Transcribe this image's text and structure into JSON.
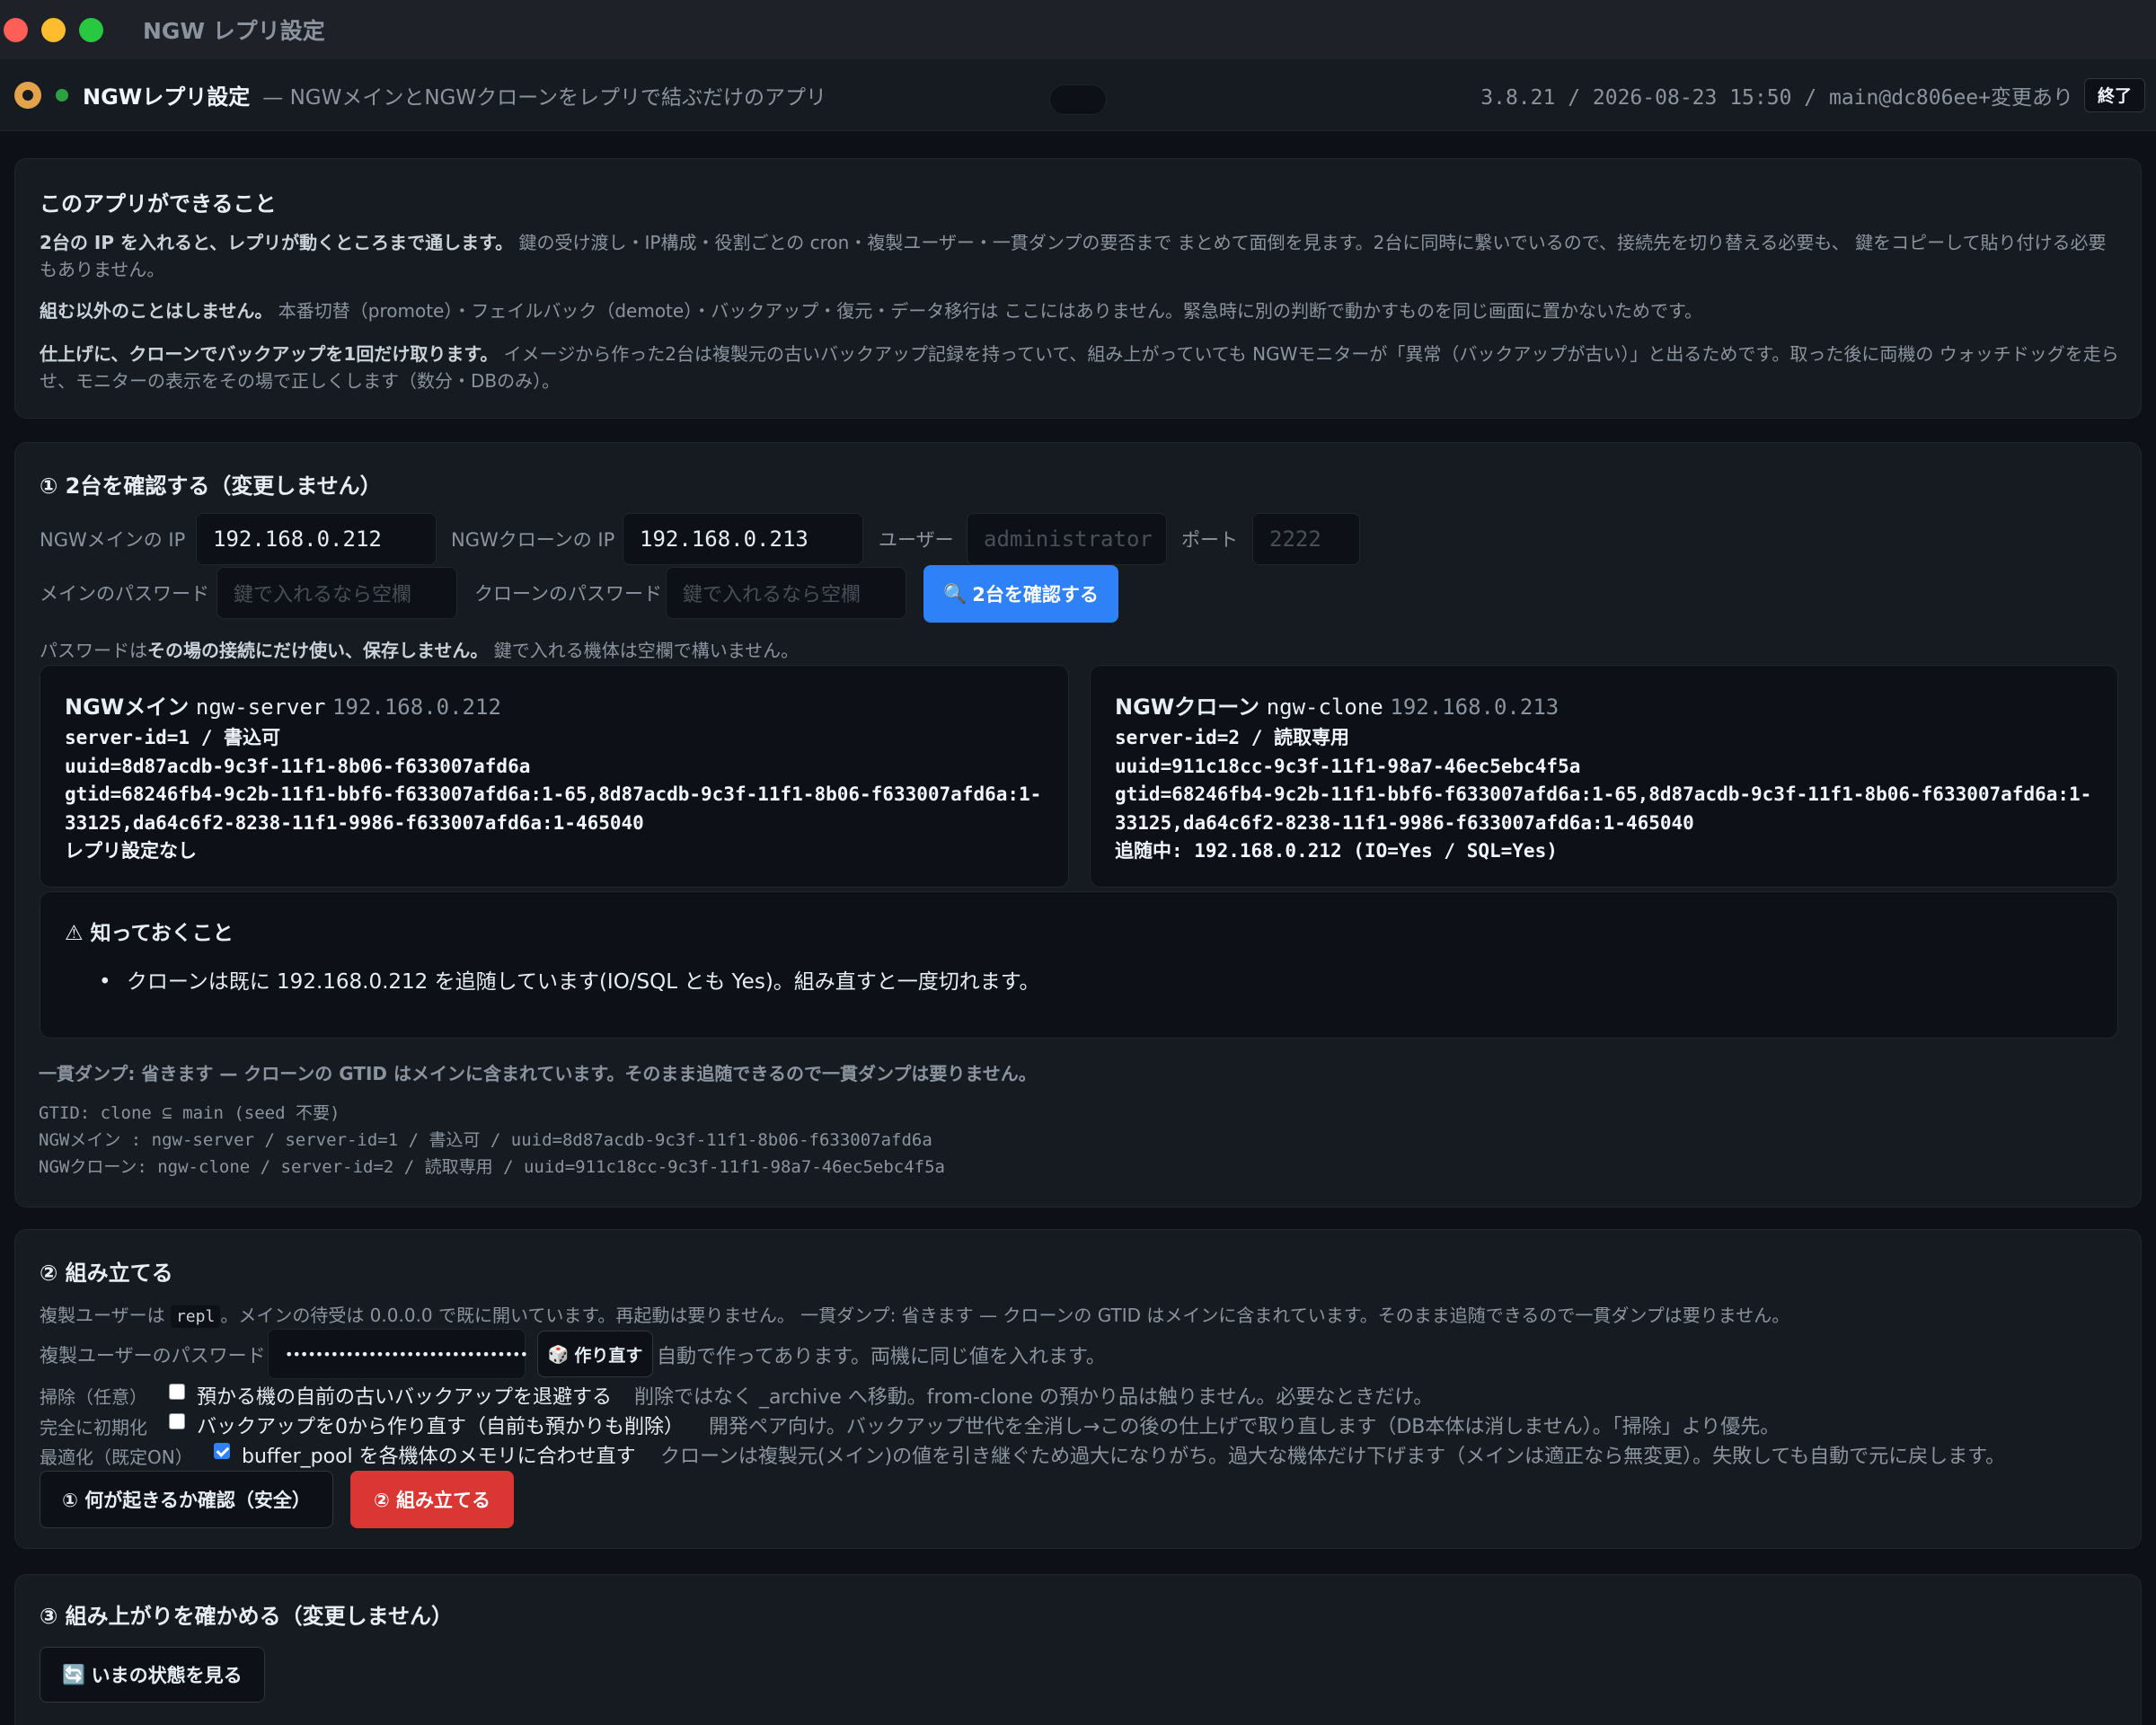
{
  "window": {
    "title": "NGW レプリ設定"
  },
  "header": {
    "app_name": "NGWレプリ設定",
    "description": "— NGWメインとNGWクローンをレプリで結ぶだけのアプリ",
    "version": "3.8.21 / 2026-08-23 15:50 / main@dc806ee+変更あり",
    "quit_label": "終了"
  },
  "intro": {
    "title": "このアプリができること",
    "p1_bold": "2台の IP を入れると、レプリが動くところまで通します。",
    "p1_text": " 鍵の受け渡し・IP構成・役割ごとの cron・複製ユーザー・一貫ダンプの要否まで まとめて面倒を見ます。2台に同時に繋いでいるので、接続先を切り替える必要も、 鍵をコピーして貼り付ける必要もありません。",
    "p2_bold": "組む以外のことはしません。",
    "p2_text": " 本番切替（promote）・フェイルバック（demote）・バックアップ・復元・データ移行は ここにはありません。緊急時に別の判断で動かすものを同じ画面に置かないためです。",
    "p3_bold": "仕上げに、クローンでバックアップを1回だけ取ります。",
    "p3_text": " イメージから作った2台は複製元の古いバックアップ記録を持っていて、組み上がっていても NGWモニターが「異常（バックアップが古い）」と出るためです。取った後に両機の ウォッチドッグを走らせ、モニターの表示をその場で正しくします（数分・DBのみ）。"
  },
  "step1": {
    "title": "① 2台を確認する（変更しません）",
    "main_ip_label": "NGWメインの IP",
    "main_ip_value": "192.168.0.212",
    "clone_ip_label": "NGWクローンの IP",
    "clone_ip_value": "192.168.0.213",
    "user_label": "ユーザー",
    "user_placeholder": "administrator",
    "port_label": "ポート",
    "port_placeholder": "2222",
    "main_pw_label": "メインのパスワード",
    "main_pw_placeholder": "鍵で入れるなら空欄",
    "clone_pw_label": "クローンのパスワード",
    "clone_pw_placeholder": "鍵で入れるなら空欄",
    "check_button": "2台を確認する",
    "note_plain1": "パスワードは",
    "note_bold": "その場の接続にだけ使い、保存しません。",
    "note_plain2": " 鍵で入れる機体は空欄で構いません。",
    "main_box": {
      "role": "NGWメイン",
      "host": "ngw-server",
      "ip": "192.168.0.212",
      "lines": [
        "server-id=1 / 書込可",
        "uuid=8d87acdb-9c3f-11f1-8b06-f633007afd6a",
        "gtid=68246fb4-9c2b-11f1-bbf6-f633007afd6a:1-65,8d87acdb-9c3f-11f1-8b06-f633007afd6a:1-",
        "33125,da64c6f2-8238-11f1-9986-f633007afd6a:1-465040",
        "レプリ設定なし"
      ]
    },
    "clone_box": {
      "role": "NGWクローン",
      "host": "ngw-clone",
      "ip": "192.168.0.213",
      "lines": [
        "server-id=2 / 読取専用",
        "uuid=911c18cc-9c3f-11f1-98a7-46ec5ebc4f5a",
        "gtid=68246fb4-9c2b-11f1-bbf6-f633007afd6a:1-65,8d87acdb-9c3f-11f1-8b06-f633007afd6a:1-",
        "33125,da64c6f2-8238-11f1-9986-f633007afd6a:1-465040",
        "追随中: 192.168.0.212 (IO=Yes / SQL=Yes)"
      ]
    },
    "notice_title": "知っておくこと",
    "notice_items": [
      "クローンは既に 192.168.0.212 を追随しています(IO/SQL とも Yes)。組み直すと一度切れます。"
    ],
    "dump_summary": "一貫ダンプ: 省きます — クローンの GTID はメインに含まれています。そのまま追随できるので一貫ダンプは要りません。",
    "mono_lines": [
      "GTID: clone ⊆ main (seed 不要)",
      "NGWメイン : ngw-server / server-id=1 / 書込可 / uuid=8d87acdb-9c3f-11f1-8b06-f633007afd6a",
      "NGWクローン: ngw-clone / server-id=2 / 読取専用 / uuid=911c18cc-9c3f-11f1-98a7-46ec5ebc4f5a"
    ]
  },
  "step2": {
    "title": "② 組み立てる",
    "repl_text_before": "複製ユーザーは",
    "repl_user_code": "repl",
    "repl_text_after": "。メインの待受は 0.0.0.0 で既に開いています。再起動は要りません。 一貫ダンプ: 省きます — クローンの GTID はメインに含まれています。そのまま追随できるので一貫ダンプは要りません。",
    "pw_label": "複製ユーザーのパスワード",
    "pw_value": "••••••••••••••••••••••••••••••••",
    "regen_button": "作り直す",
    "pw_note": "自動で作ってあります。両機に同じ値を入れます。",
    "options": [
      {
        "label": "掃除（任意）",
        "checked": false,
        "title": "預かる機の自前の古いバックアップを退避する",
        "note": "削除ではなく _archive へ移動。from-clone の預かり品は触りません。必要なときだけ。"
      },
      {
        "label": "完全に初期化",
        "checked": false,
        "title": "バックアップを0から作り直す（自前も預かりも削除）",
        "note": "開発ペア向け。バックアップ世代を全消し→この後の仕上げで取り直します（DB本体は消しません）。「掃除」より優先。"
      },
      {
        "label": "最適化（既定ON）",
        "checked": true,
        "title": "buffer_pool を各機体のメモリに合わせ直す",
        "note": "クローンは複製元(メイン)の値を引き継ぐため過大になりがち。過大な機体だけ下げます（メインは適正なら無変更）。失敗しても自動で元に戻します。"
      }
    ],
    "dryrun_button": "① 何が起きるか確認（安全）",
    "build_button": "② 組み立てる"
  },
  "step3": {
    "title": "③ 組み上がりを確かめる（変更しません）",
    "status_button": "いまの状態を見る"
  },
  "colors": {
    "background": "#0d1117",
    "card": "#161b22",
    "accent_blue": "#2f81f7",
    "danger_red": "#da3633",
    "status_green": "#2ea043"
  }
}
